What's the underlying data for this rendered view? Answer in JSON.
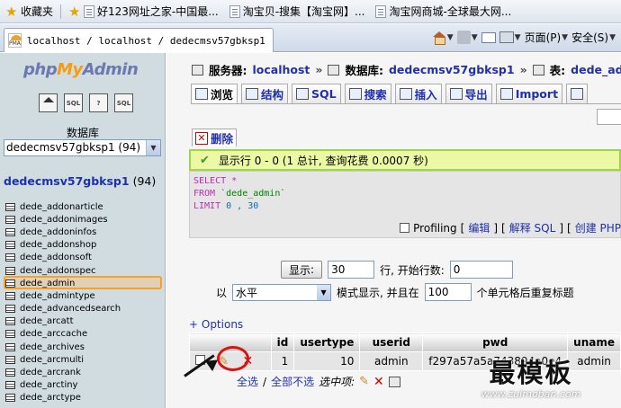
{
  "browser": {
    "favorites_bar": [
      "收藏夹",
      "好123网址之家-中国最...",
      "淘宝贝-搜集【淘宝网】...",
      "淘宝网商城-全球最大网..."
    ],
    "tab_title": "localhost / localhost / dedecmsv57gbksp1 ...",
    "toolbar": {
      "page_label": "页面(P)",
      "safety_label": "安全(S)"
    }
  },
  "sidebar": {
    "logo": {
      "php": "php",
      "my": "My",
      "admin": "Admin"
    },
    "icons": [
      "home-icon",
      "sql-icon",
      "help-icon",
      "docs-icon"
    ],
    "db_label": "数据库",
    "db_select": "dedecmsv57gbksp1 (94)",
    "db_name": "dedecmsv57gbksp1",
    "db_count": "(94)",
    "tables": [
      "dede_addonarticle",
      "dede_addonimages",
      "dede_addoninfos",
      "dede_addonshop",
      "dede_addonsoft",
      "dede_addonspec",
      "dede_admin",
      "dede_admintype",
      "dede_advancedsearch",
      "dede_arcatt",
      "dede_arccache",
      "dede_archives",
      "dede_arcmulti",
      "dede_arcrank",
      "dede_arctiny",
      "dede_arctype"
    ],
    "active_table": "dede_admin"
  },
  "breadcrumb": {
    "server_label": "服务器:",
    "server": "localhost",
    "db_label": "数据库:",
    "db": "dedecmsv57gbksp1",
    "table_label": "表:",
    "table": "dede_admin"
  },
  "tabs": [
    "浏览",
    "结构",
    "SQL",
    "搜索",
    "插入",
    "导出",
    "Import"
  ],
  "delete_label": "删除",
  "success_msg": "显示行 0 - 0 (1 总计, 查询花费 0.0007 秒)",
  "sql": {
    "line1": "SELECT *",
    "from_kw": "FROM",
    "from_tbl": "`dede_admin`",
    "limit_kw": "LIMIT",
    "limit_vals": "0 , 30"
  },
  "profiling": {
    "profiling": "Profiling",
    "edit": "编辑",
    "explain": "解释 SQL",
    "create": "创建 PHP"
  },
  "display": {
    "show_btn": "显示",
    "rows": "30",
    "start_label": "行, 开始行数:",
    "start": "0",
    "with_label": "以",
    "mode": "水平",
    "mode_label": "模式显示, 并且在",
    "repeat": "100",
    "repeat_label": "个单元格后重复标题"
  },
  "options_label": "+ Options",
  "grid": {
    "headers": [
      "id",
      "usertype",
      "userid",
      "pwd",
      "uname"
    ],
    "row": {
      "id": "1",
      "usertype": "10",
      "userid": "admin",
      "pwd": "f297a57a5a743894a0e4",
      "uname": "admin"
    }
  },
  "bottom": {
    "select_all": "全选",
    "slash": "/",
    "deselect_all": "全部不选",
    "with_selected": "选中项:"
  },
  "watermark": {
    "title": "最模板",
    "url": "www.zuimoban.com"
  }
}
